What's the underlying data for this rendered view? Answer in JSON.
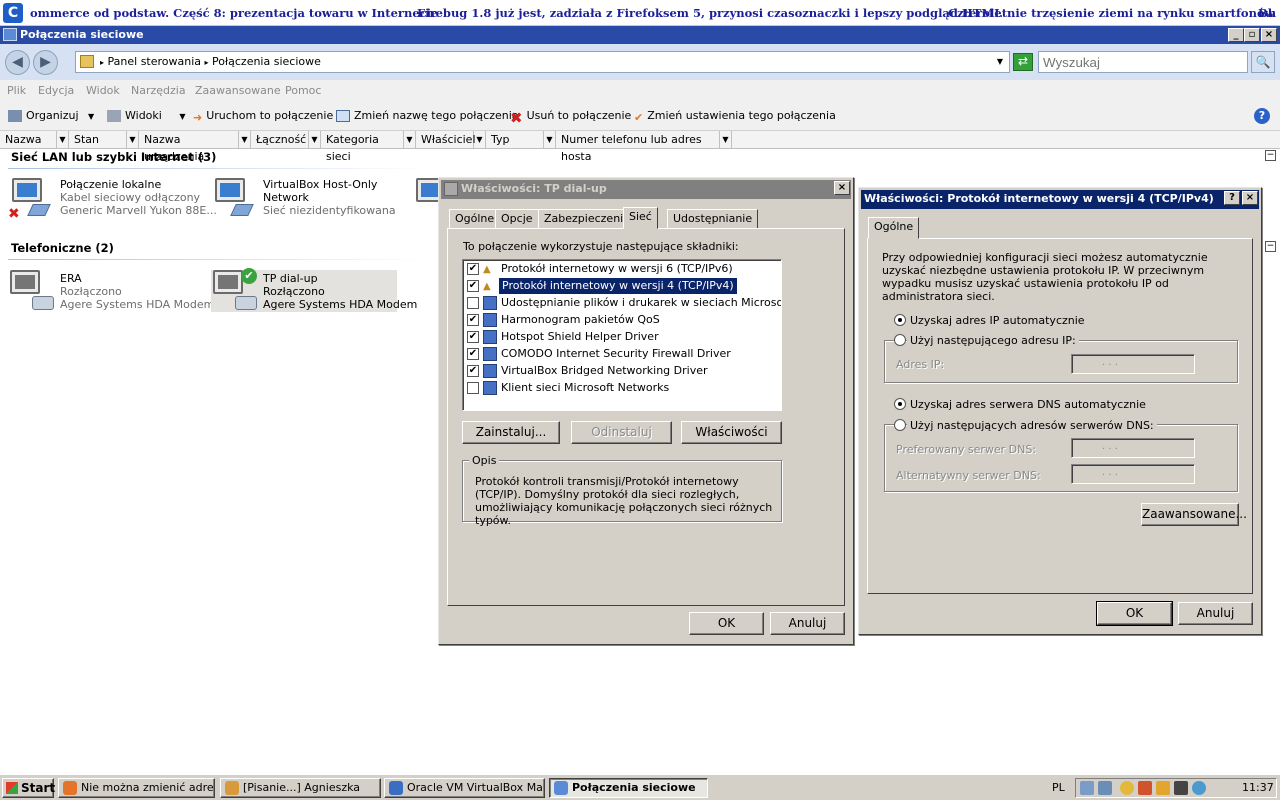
{
  "ticker": {
    "logo": "C",
    "headlines": [
      "ommerce od podstaw. Część 8: prezentacja towaru w Internecie",
      "Firebug 1.8 już jest, zadziała z Firefoksem 5, przynosi czasoznaczki i lepszy podgląd HTML",
      "Czteroletnie trzęsienie ziemi na rynku smartfonów",
      "Bh"
    ]
  },
  "window": {
    "title": "Połączenia sieciowe",
    "controls": {
      "minimize": "_",
      "maximize": "▫",
      "close": "×"
    }
  },
  "address": {
    "crumbs": [
      "Panel sterowania",
      "Połączenia sieciowe"
    ],
    "search_placeholder": "Wyszukaj",
    "back_icon": "◀",
    "forward_icon": "▶",
    "go_icon": "⇄",
    "search_icon": "🔍"
  },
  "menu": [
    "Plik",
    "Edycja",
    "Widok",
    "Narzędzia",
    "Zaawansowane",
    "Pomoc"
  ],
  "toolbar": {
    "organize": "Organizuj",
    "views": "Widoki",
    "start_connection": "Uruchom to połączenie",
    "rename": "Zmień nazwę tego połączenia",
    "delete": "Usuń to połączenie",
    "change_settings": "Zmień ustawienia tego połączenia",
    "help_icon": "?"
  },
  "columns": [
    "Nazwa",
    "Stan",
    "Nazwa urządzenia",
    "Łączność",
    "Kategoria sieci",
    "Właściciel",
    "Typ",
    "Numer telefonu lub adres hosta"
  ],
  "groups": {
    "lan": {
      "title": "Sieć LAN lub szybki Internet (3)",
      "items": [
        {
          "name": "Połączenie lokalne",
          "status": "Kabel sieciowy odłączony",
          "device": "Generic Marvell Yukon 88E..."
        },
        {
          "name": "VirtualBox Host-Only",
          "name2": "Network",
          "status": "Sieć niezidentyfikowana"
        }
      ]
    },
    "dialup": {
      "title": "Telefoniczne (2)",
      "items": [
        {
          "name": "ERA",
          "status": "Rozłączono",
          "device": "Agere Systems HDA Modem"
        },
        {
          "name": "TP dial-up",
          "status": "Rozłączono",
          "device": "Agere Systems HDA Modem"
        }
      ]
    }
  },
  "dialog1": {
    "title": "Właściwości: TP dial-up",
    "close": "×",
    "tabs": [
      "Ogólne",
      "Opcje",
      "Zabezpieczenia",
      "Sieć",
      "Udostępnianie"
    ],
    "components_label": "To połączenie wykorzystuje następujące składniki:",
    "components": [
      {
        "label": "Protokół internetowy w wersji 6 (TCP/IPv6)",
        "checked": true
      },
      {
        "label": "Protokół internetowy w wersji 4 (TCP/IPv4)",
        "checked": true
      },
      {
        "label": "Udostępnianie plików i drukarek w sieciach Microsoft Net...",
        "checked": false
      },
      {
        "label": "Harmonogram pakietów QoS",
        "checked": true
      },
      {
        "label": "Hotspot Shield Helper Driver",
        "checked": true
      },
      {
        "label": "COMODO Internet Security Firewall Driver",
        "checked": true
      },
      {
        "label": "VirtualBox Bridged Networking Driver",
        "checked": true
      },
      {
        "label": "Klient sieci Microsoft Networks",
        "checked": false
      }
    ],
    "check_mark": "✔",
    "install": "Zainstaluj...",
    "uninstall": "Odinstaluj",
    "properties": "Właściwości",
    "desc_legend": "Opis",
    "desc_text": "Protokół kontroli transmisji/Protokół internetowy (TCP/IP). Domyślny protokół dla sieci rozległych, umożliwiający komunikację połączonych sieci różnych typów.",
    "ok": "OK",
    "cancel": "Anuluj"
  },
  "dialog2": {
    "title": "Właściwości: Protokół internetowy w wersji 4 (TCP/IPv4)",
    "help": "?",
    "close": "×",
    "tab": "Ogólne",
    "intro": "Przy odpowiedniej konfiguracji sieci możesz automatycznie uzyskać niezbędne ustawienia protokołu IP. W przeciwnym wypadku musisz uzyskać ustawienia protokołu IP od administratora sieci.",
    "auto_ip": "Uzyskaj adres IP automatycznie",
    "manual_ip": "Użyj następującego adresu IP:",
    "ip_label": "Adres IP:",
    "auto_dns": "Uzyskaj adres serwera DNS automatycznie",
    "manual_dns": "Użyj następujących adresów serwerów DNS:",
    "pref_dns": "Preferowany serwer DNS:",
    "alt_dns": "Alternatywny serwer DNS:",
    "ip_dots": ".       .       .",
    "advanced": "Zaawansowane...",
    "ok": "OK",
    "cancel": "Anuluj"
  },
  "taskbar": {
    "start": "Start",
    "tasks": [
      "Nie można zmienić adres...",
      "[Pisanie...] Agnieszka",
      "Oracle VM VirtualBox Ma...",
      "Połączenia sieciowe"
    ],
    "lang": "PL",
    "clock": "11:37"
  },
  "colors": {
    "title_active": "#0a246a",
    "title_inactive": "#808080",
    "window_title": "#2a4aa8",
    "selection": "#0a246a"
  }
}
